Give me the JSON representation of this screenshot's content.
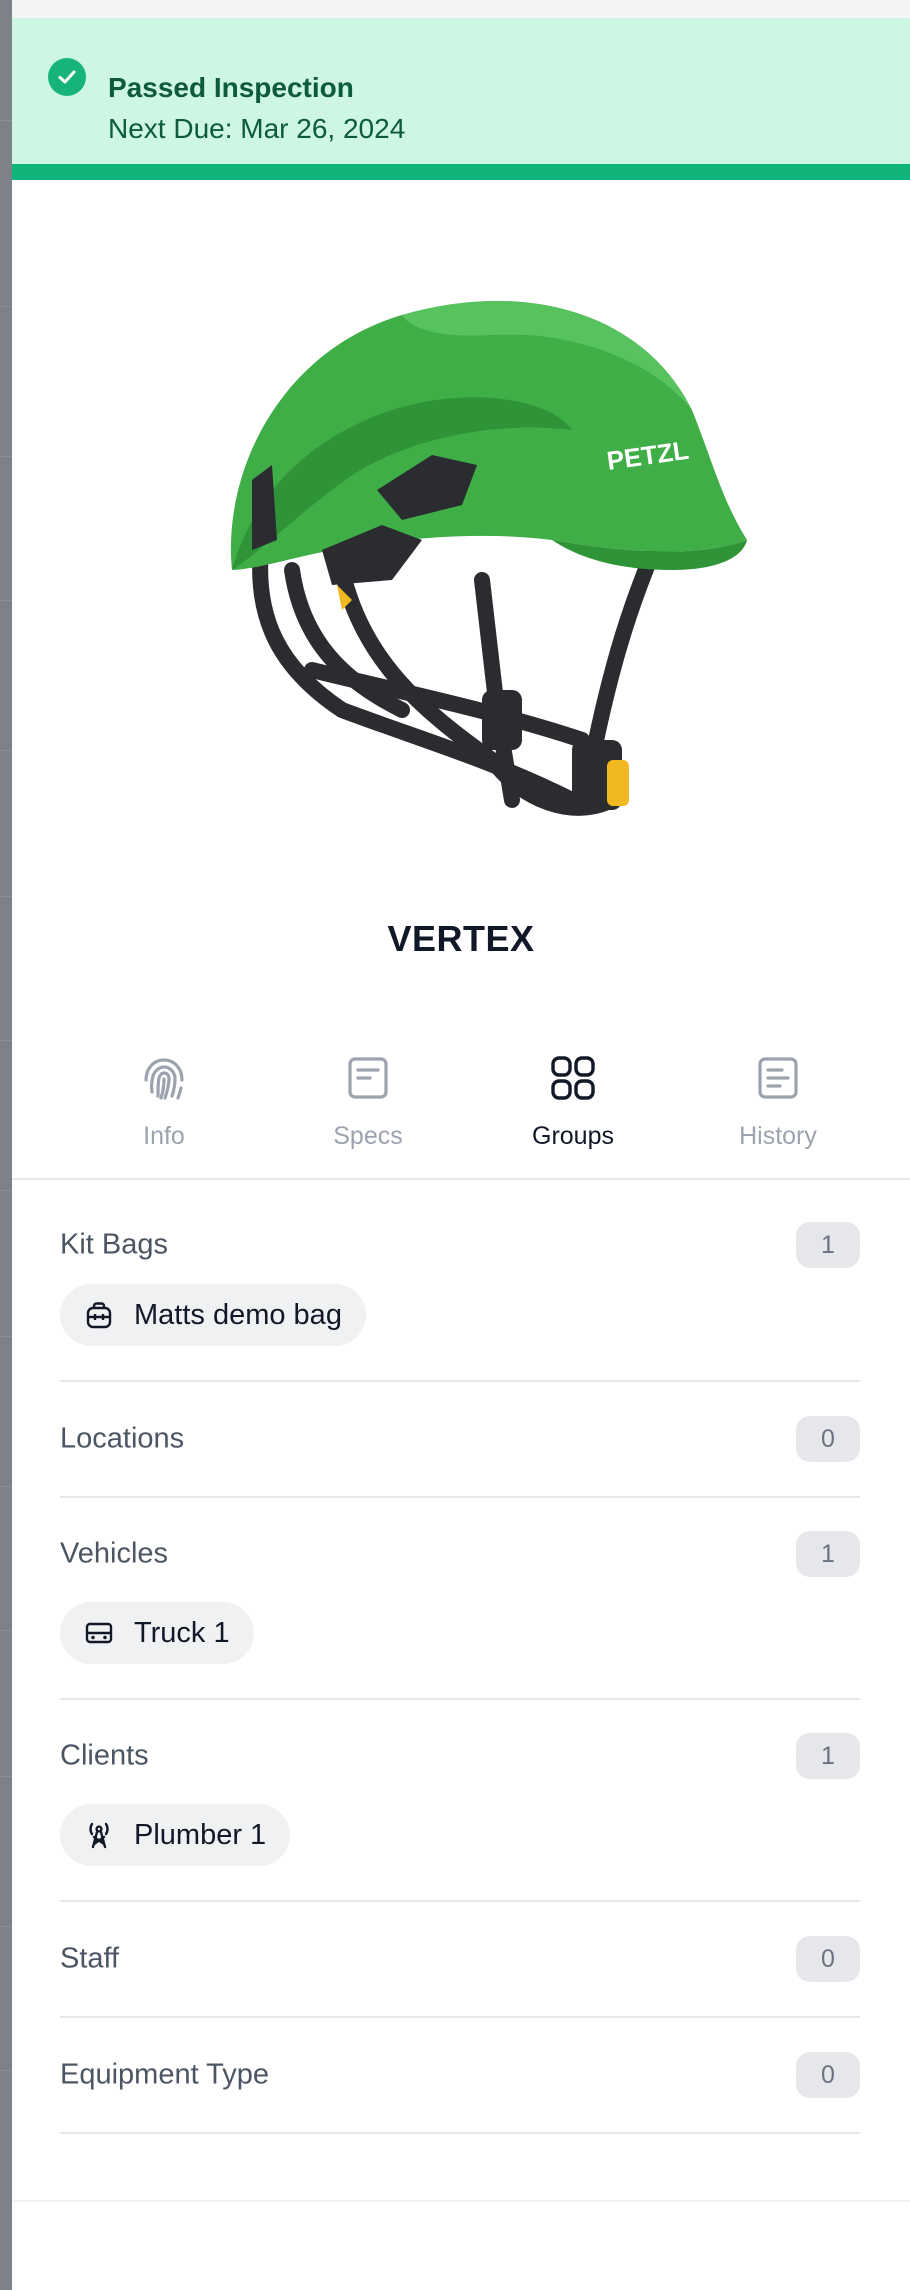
{
  "status": {
    "title": "Passed Inspection",
    "next_due": "Next Due: Mar 26, 2024",
    "accent": "#11b57a",
    "background": "#cdf7e2"
  },
  "product": {
    "name": "VERTEX",
    "image": "green-climbing-helmet",
    "image_brand_mark": "PETZL"
  },
  "tabs": [
    {
      "label": "Info",
      "icon": "fingerprint-icon",
      "active": false
    },
    {
      "label": "Specs",
      "icon": "document-icon",
      "active": false
    },
    {
      "label": "Groups",
      "icon": "grid-icon",
      "active": true
    },
    {
      "label": "History",
      "icon": "list-document-icon",
      "active": false
    }
  ],
  "groups": [
    {
      "name": "Kit Bags",
      "count": "1",
      "items": [
        {
          "label": "Matts demo bag",
          "icon": "bag-icon"
        }
      ]
    },
    {
      "name": "Locations",
      "count": "0",
      "items": []
    },
    {
      "name": "Vehicles",
      "count": "1",
      "items": [
        {
          "label": "Truck 1",
          "icon": "vehicle-icon"
        }
      ]
    },
    {
      "name": "Clients",
      "count": "1",
      "items": [
        {
          "label": "Plumber 1",
          "icon": "tower-icon"
        }
      ]
    },
    {
      "name": "Staff",
      "count": "0",
      "items": []
    },
    {
      "name": "Equipment Type",
      "count": "0",
      "items": []
    }
  ]
}
